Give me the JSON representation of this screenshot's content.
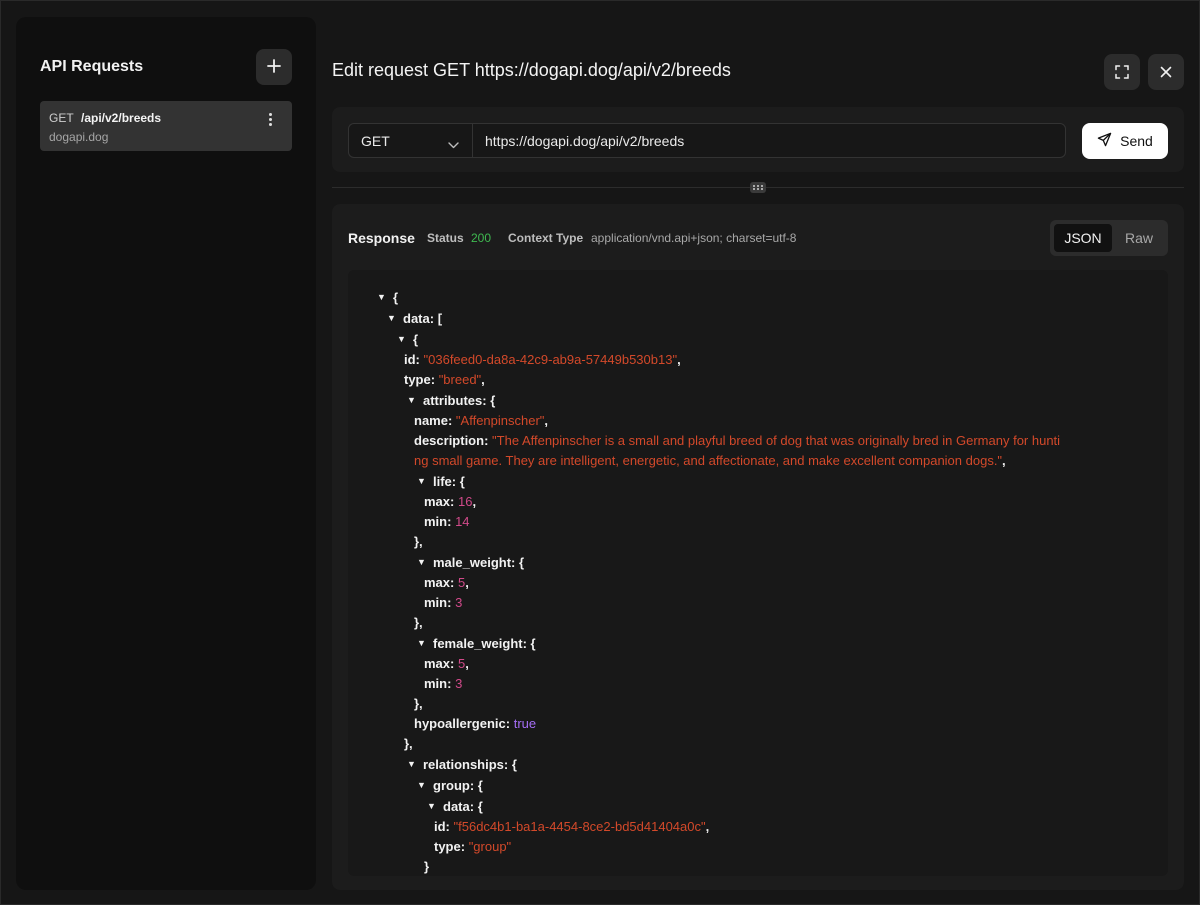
{
  "sidebar": {
    "title": "API Requests",
    "add_icon": "plus-icon",
    "items": [
      {
        "method": "GET",
        "path": "/api/v2/breeds",
        "host": "dogapi.dog"
      }
    ]
  },
  "header": {
    "title": "Edit request GET https://dogapi.dog/api/v2/breeds",
    "fullscreen_icon": "fullscreen-icon",
    "close_icon": "close-icon"
  },
  "request": {
    "method": "GET",
    "url": "https://dogapi.dog/api/v2/breeds",
    "send_label": "Send"
  },
  "response": {
    "label": "Response",
    "status_key": "Status",
    "status_value": "200",
    "content_type_key": "Context Type",
    "content_type_value": "application/vnd.api+json; charset=utf-8",
    "view_json": "JSON",
    "view_raw": "Raw",
    "json": {
      "open_brace": "{",
      "data_key": "data:",
      "data_open": "[",
      "item_open": "{",
      "id_key": "id:",
      "id_val": "\"036feed0-da8a-42c9-ab9a-57449b530b13\"",
      "type_key": "type:",
      "type_val": "\"breed\"",
      "attributes_key": "attributes:",
      "name_key": "name:",
      "name_val": "\"Affenpinscher\"",
      "description_key": "description:",
      "description_line1": "\"The Affenpinscher is a small and playful breed of dog that was originally bred in Germany for hunti",
      "description_line2": "ng small game. They are intelligent, energetic, and affectionate, and make excellent companion dogs.\"",
      "life_key": "life:",
      "life_max": "16",
      "life_min": "14",
      "male_weight_key": "male_weight:",
      "male_max": "5",
      "male_min": "3",
      "female_weight_key": "female_weight:",
      "female_max": "5",
      "female_min": "3",
      "max_key": "max:",
      "min_key": "min:",
      "hypoallergenic_key": "hypoallergenic:",
      "hypoallergenic_val": "true",
      "relationships_key": "relationships:",
      "group_key": "group:",
      "inner_data_key": "data:",
      "group_id_val": "\"f56dc4b1-ba1a-4454-8ce2-bd5d41404a0c\"",
      "group_type_val": "\"group\""
    }
  },
  "colors": {
    "status_ok": "#3fb950",
    "string": "#d3492a",
    "number": "#d14a8a",
    "boolean": "#a56ef5"
  }
}
